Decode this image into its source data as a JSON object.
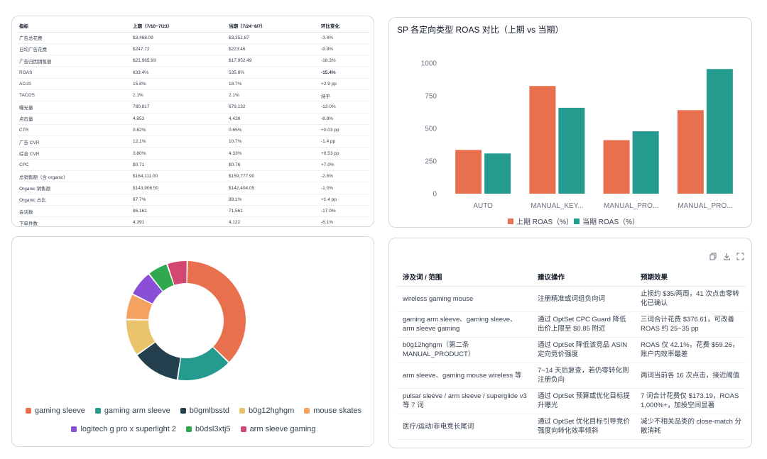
{
  "metrics_table": {
    "headers": [
      "指标",
      "上期（7/10~7/23）",
      "当期（7/24~8/7）",
      "环比变化"
    ],
    "rows": [
      [
        "广告总花费",
        "$3,468.09",
        "$3,351.87",
        "-3.4%"
      ],
      [
        "日均广告花费",
        "$247.72",
        "$223.46",
        "-9.8%"
      ],
      [
        "广告归因销售额",
        "$21,965.93",
        "$17,952.49",
        "-18.3%"
      ],
      [
        "ROAS",
        "633.4%",
        "535.6%",
        "-15.4%"
      ],
      [
        "ACoS",
        "15.8%",
        "18.7%",
        "+2.9 pp"
      ],
      [
        "TACOS",
        "2.1%",
        "2.1%",
        "持平"
      ],
      [
        "曝光量",
        "780,817",
        "679,132",
        "-13.0%"
      ],
      [
        "点击量",
        "4,853",
        "4,426",
        "-8.8%"
      ],
      [
        "CTR",
        "0.62%",
        "0.65%",
        "+0.03 pp"
      ],
      [
        "广告 CVR",
        "12.1%",
        "10.7%",
        "-1.4 pp"
      ],
      [
        "综合 CVR",
        "3.80%",
        "4.33%",
        "+0.53 pp"
      ],
      [
        "CPC",
        "$0.71",
        "$0.76",
        "+7.0%"
      ],
      [
        "总销售额（含 organic）",
        "$164,111.00",
        "$159,777.90",
        "-2.6%"
      ],
      [
        "Organic 销售额",
        "$143,906.50",
        "$142,404.05",
        "-1.0%"
      ],
      [
        "Organic 占比",
        "87.7%",
        "89.1%",
        "+1.4 pp"
      ],
      [
        "会话数",
        "86,161",
        "71,561",
        "-17.0%"
      ],
      [
        "下单件数",
        "4,391",
        "4,122",
        "-6.1%"
      ]
    ]
  },
  "bar_card": {
    "title": "SP 各定向类型 ROAS 对比（上期 vs 当期）"
  },
  "chart_data": [
    {
      "type": "bar",
      "title": "SP 各定向类型 ROAS 对比（上期 vs 当期）",
      "categories": [
        "AUTO",
        "MANUAL_KEY...",
        "MANUAL_PRO...",
        "MANUAL_PRO..."
      ],
      "series": [
        {
          "name": "上期 ROAS（%）",
          "color": "#e8704f",
          "values": [
            335,
            825,
            410,
            640
          ]
        },
        {
          "name": "当期 ROAS（%）",
          "color": "#259b8f",
          "values": [
            308,
            658,
            478,
            955
          ]
        }
      ],
      "yticks": [
        "0",
        "250",
        "500",
        "750",
        "1000"
      ],
      "ylim": [
        0,
        1000
      ],
      "grid": false,
      "legend": "bottom"
    },
    {
      "type": "pie",
      "variant": "donut",
      "legend": "bottom",
      "slices": [
        {
          "name": "gaming sleeve",
          "value": 37,
          "color": "#e8704f"
        },
        {
          "name": "gaming arm sleeve",
          "value": 15,
          "color": "#259b8f"
        },
        {
          "name": "b0gmlbsstd",
          "value": 13,
          "color": "#24404f"
        },
        {
          "name": "b0g12hghgm",
          "value": 10,
          "color": "#e9c46a"
        },
        {
          "name": "mouse skates",
          "value": 7,
          "color": "#f4a261"
        },
        {
          "name": "logitech g pro x superlight 2",
          "value": 7,
          "color": "#8a4fd6"
        },
        {
          "name": "b0dsl3xtj5",
          "value": 5.5,
          "color": "#2fa84f"
        },
        {
          "name": "arm sleeve gaming",
          "value": 5.5,
          "color": "#d14873"
        }
      ]
    }
  ],
  "suggest_table": {
    "toolbar_icons": [
      "copy-icon",
      "download-icon",
      "expand-icon"
    ],
    "headers": [
      "涉及词 / 范围",
      "建议操作",
      "预期效果"
    ],
    "rows": [
      [
        "wireless gaming mouse",
        "注册精准或词组负向词",
        "止损约 $35/两周，41 次点击零转化已确认"
      ],
      [
        "gaming arm sleeve、gaming sleeve、arm sleeve gaming",
        "通过 OptSet CPC Guard 降低出价上限至 $0.85 附近",
        "三词合计花费 $376.61，可改善 ROAS 约 25~35 pp"
      ],
      [
        "b0g12hghgm（第二条 MANUAL_PRODUCT）",
        "通过 OptSet 降低该竞品 ASIN 定向竞价强度",
        "ROAS 仅 42.1%，花费 $59.26，账户内效率最差"
      ],
      [
        "arm sleeve、gaming mouse wireless 等",
        "7~14 天后复查，若仍零转化则注册负向",
        "两词当前各 16 次点击，接近阈值"
      ],
      [
        "pulsar sleeve / arm sleeve / superglide v3 等 7 词",
        "通过 OptSet 预算或优化目标提升曝光",
        "7 词合计花费仅 $173.19，ROAS 1,000%+，加投空间显著"
      ],
      [
        "医疗/运动/非电竞长尾词",
        "通过 OptSet 优化目标引导竞价强度向转化效率倾斜",
        "减少不相关品类的 close-match 分散消耗"
      ]
    ]
  }
}
